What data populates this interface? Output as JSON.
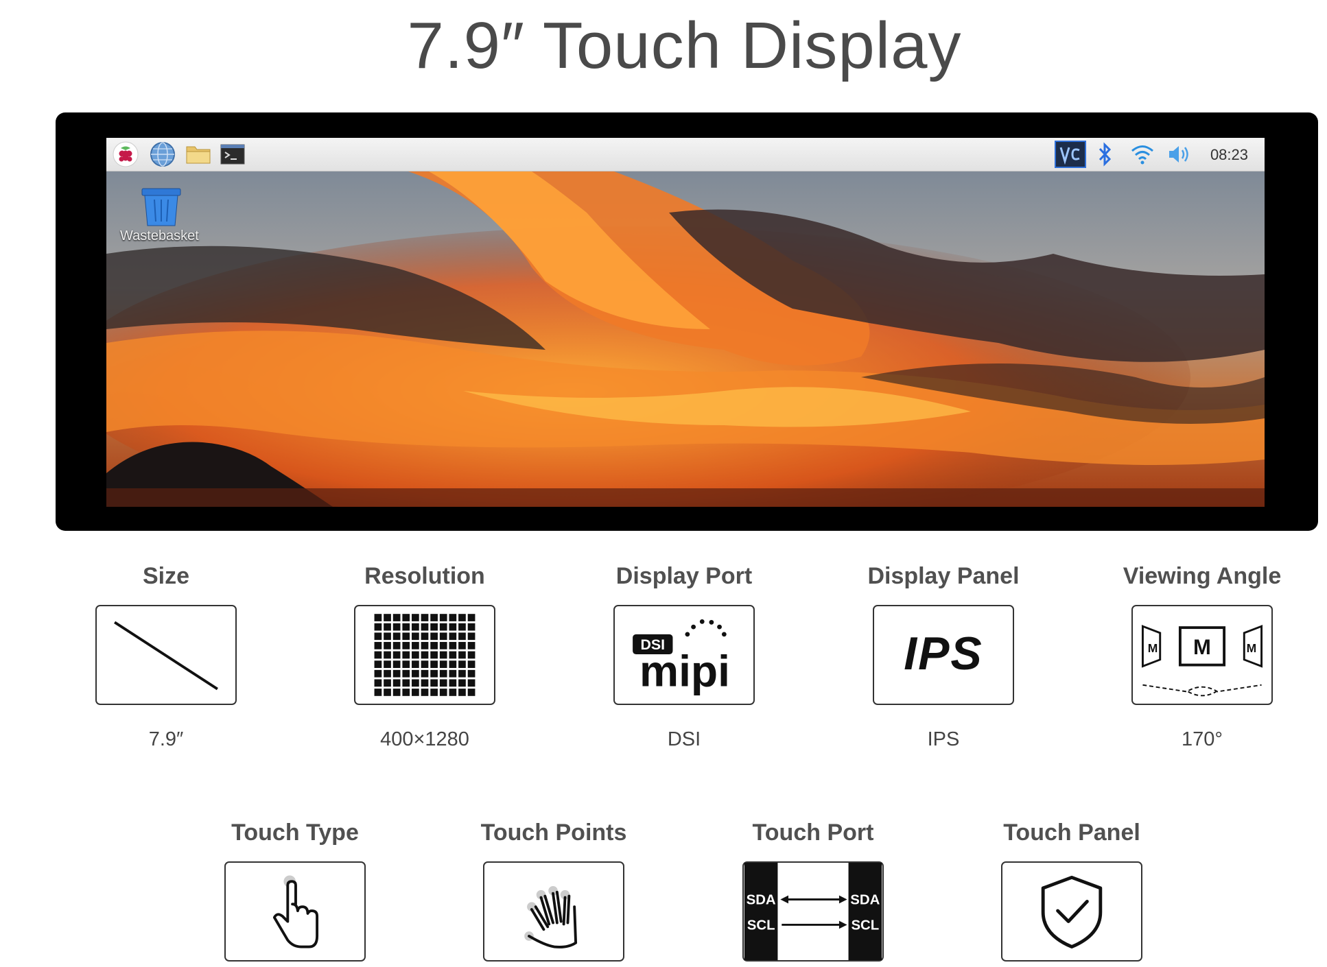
{
  "page": {
    "title": "7.9″ Touch Display"
  },
  "desktop": {
    "clock": "08:23",
    "wastebasket_label": "Wastebasket",
    "taskbar_icons": [
      "raspberry-icon",
      "globe-icon",
      "folder-icon",
      "terminal-icon",
      "vnc-icon",
      "bluetooth-icon",
      "wifi-icon",
      "volume-icon"
    ]
  },
  "specs_row1": [
    {
      "label": "Size",
      "value": "7.9″",
      "icon": "diagonal-line-icon"
    },
    {
      "label": "Resolution",
      "value": "400×1280",
      "icon": "pixel-grid-icon"
    },
    {
      "label": "Display Port",
      "value": "DSI",
      "icon": "mipi-dsi-icon",
      "badge": "DSI",
      "logo_text": "mipi"
    },
    {
      "label": "Display Panel",
      "value": "IPS",
      "icon": "ips-icon",
      "logo_text": "IPS"
    },
    {
      "label": "Viewing Angle",
      "value": "170°",
      "icon": "viewing-angle-icon",
      "glyphs": [
        "M",
        "M",
        "M"
      ]
    }
  ],
  "specs_row2": [
    {
      "label": "Touch Type",
      "icon": "single-touch-hand-icon"
    },
    {
      "label": "Touch Points",
      "icon": "multi-touch-hand-icon"
    },
    {
      "label": "Touch Port",
      "icon": "i2c-port-icon",
      "pins": [
        "SDA",
        "SCL",
        "SDA",
        "SCL"
      ]
    },
    {
      "label": "Touch Panel",
      "icon": "shield-check-icon"
    }
  ],
  "colors": {
    "title": "#4a4a4a",
    "label": "#505050",
    "bezel": "#000000"
  }
}
